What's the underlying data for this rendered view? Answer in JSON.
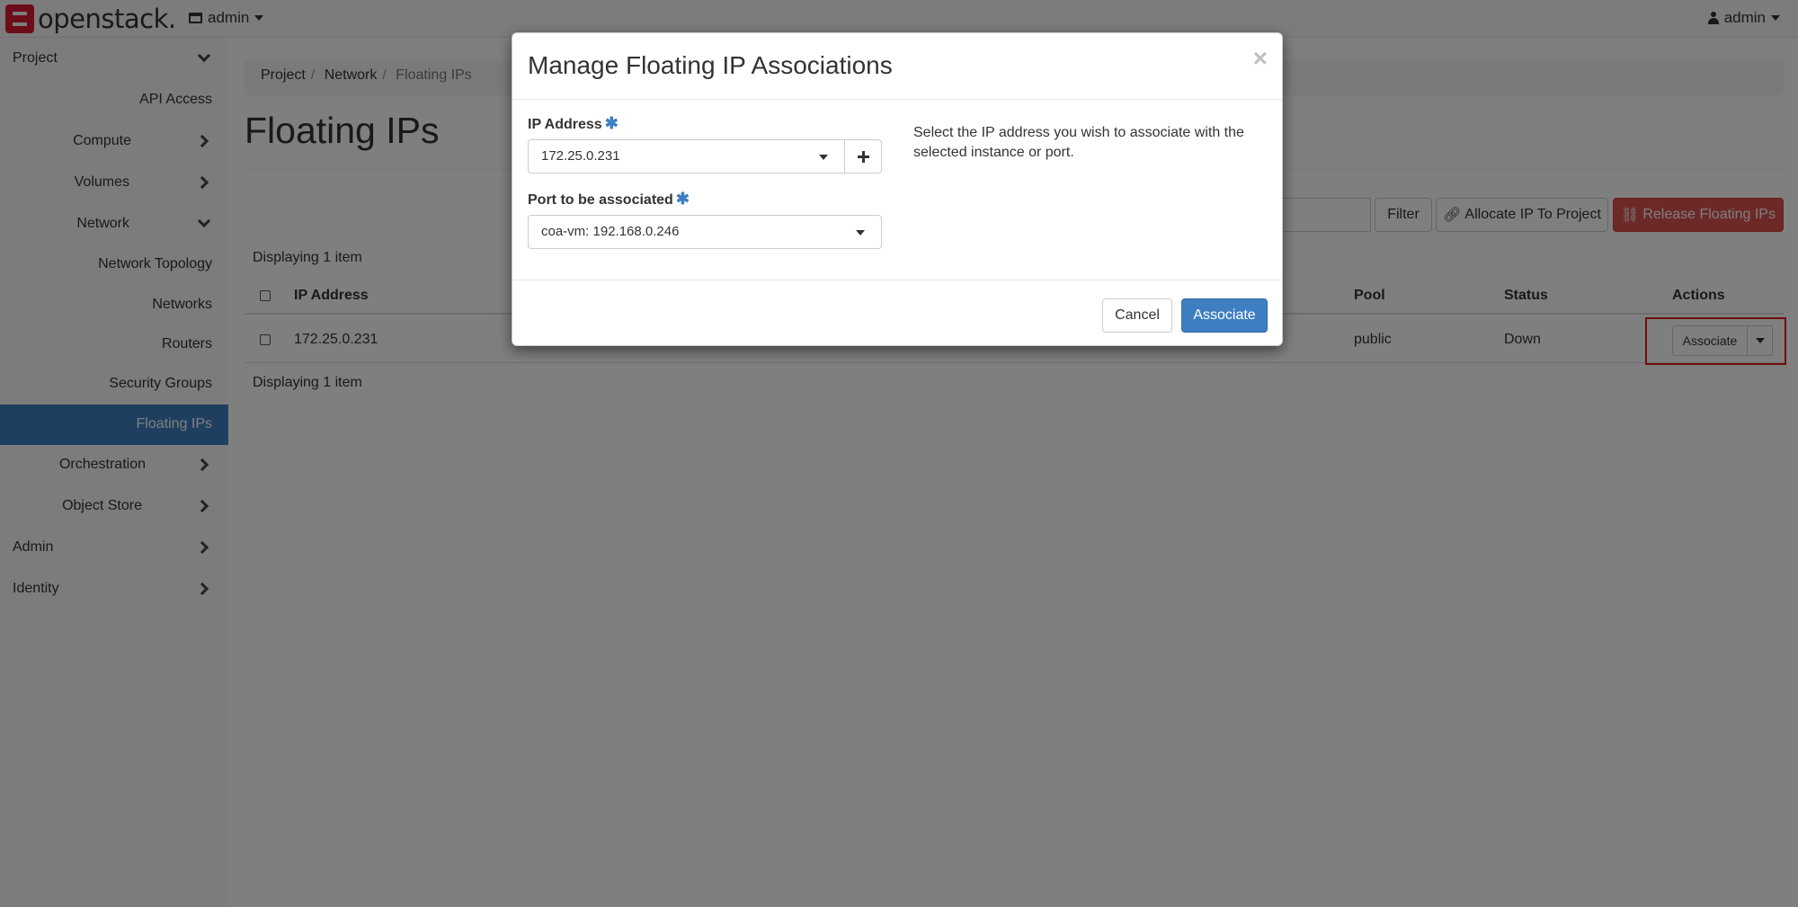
{
  "navbar": {
    "brand": "openstack.",
    "project": "admin",
    "user": "admin"
  },
  "sidebar": {
    "project": "Project",
    "api_access": "API Access",
    "compute": "Compute",
    "volumes": "Volumes",
    "network": "Network",
    "network_topology": "Network Topology",
    "networks": "Networks",
    "routers": "Routers",
    "security_groups": "Security Groups",
    "floating_ips": "Floating IPs",
    "orchestration": "Orchestration",
    "object_store": "Object Store",
    "admin": "Admin",
    "identity": "Identity"
  },
  "breadcrumb": [
    "Project",
    "Network",
    "Floating IPs"
  ],
  "page_title": "Floating IPs",
  "toolbar": {
    "filter": "Filter",
    "allocate": "Allocate IP To Project",
    "release": "Release Floating IPs"
  },
  "table": {
    "displaying": "Displaying 1 item",
    "headers": {
      "ip_address": "IP Address",
      "pool": "Pool",
      "status": "Status",
      "actions": "Actions"
    },
    "rows": [
      {
        "ip_address": "172.25.0.231",
        "pool": "public",
        "status": "Down",
        "action": "Associate"
      }
    ]
  },
  "modal": {
    "title": "Manage Floating IP Associations",
    "close": "×",
    "ip_label": "IP Address",
    "required_mark": "✱",
    "ip_value": "172.25.0.231",
    "port_label": "Port to be associated",
    "port_value": "coa-vm: 192.168.0.246",
    "help": "Select the IP address you wish to associate with the selected instance or port.",
    "cancel": "Cancel",
    "associate": "Associate"
  }
}
